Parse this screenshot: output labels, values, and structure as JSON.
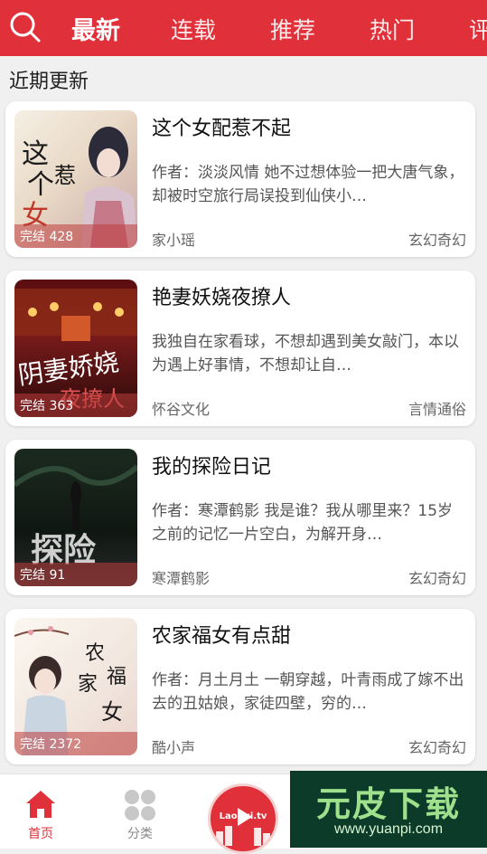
{
  "header": {
    "tabs": [
      {
        "label": "最新",
        "active": true
      },
      {
        "label": "连载",
        "active": false
      },
      {
        "label": "推荐",
        "active": false
      },
      {
        "label": "热门",
        "active": false
      },
      {
        "label": "评",
        "active": false
      }
    ],
    "search_icon": "search-icon",
    "accent_color": "#e0303a"
  },
  "section": {
    "title": "近期更新"
  },
  "books": [
    {
      "title": "这个女配惹不起",
      "description": "作者：淡淡风情 她不过想体验一把大唐气象，却被时空旅行局误投到仙侠小…",
      "author": "家小瑶",
      "genre": "玄幻奇幻",
      "badge": "完结 428"
    },
    {
      "title": "艳妻妖娆夜撩人",
      "description": "我独自在家看球，不想却遇到美女敲门，本以为遇上好事情，不想却让自…",
      "author": "怀谷文化",
      "genre": "言情通俗",
      "badge": "完结 363"
    },
    {
      "title": "我的探险日记",
      "description": "作者：寒潭鹤影 我是谁？我从哪里来？15岁之前的记忆一片空白，为解开身…",
      "author": "寒潭鹤影",
      "genre": "玄幻奇幻",
      "badge": "完结 91"
    },
    {
      "title": "农家福女有点甜",
      "description": "作者：月土月土 一朝穿越，叶青雨成了嫁不出去的丑姑娘，家徒四壁，穷的…",
      "author": "酷小声",
      "genre": "玄幻奇幻",
      "badge": "完结 2372"
    }
  ],
  "bottom_nav": {
    "items": [
      {
        "label": "首页",
        "icon": "home-icon",
        "active": true
      },
      {
        "label": "分类",
        "icon": "category-icon",
        "active": false
      }
    ],
    "center_label": "Laohui.tv"
  },
  "watermark": {
    "brand": "元皮下载",
    "url": "www.yuanpi.com"
  }
}
